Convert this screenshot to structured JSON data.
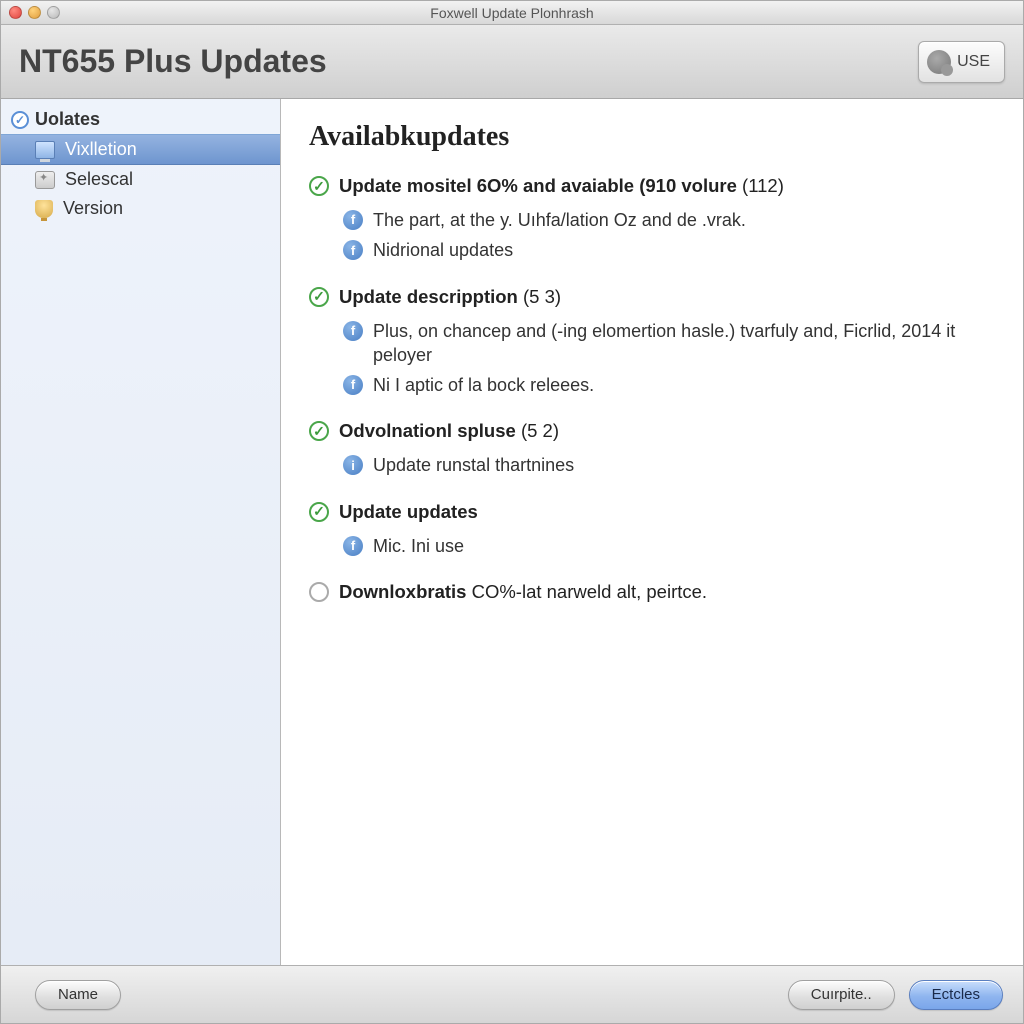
{
  "window": {
    "title": "Foxwell Update Plonhrash"
  },
  "toolbar": {
    "page_title": "NT655 Plus Updates",
    "use_button": "USE"
  },
  "sidebar": {
    "header": "Uolates",
    "items": [
      {
        "label": "Vixlletion"
      },
      {
        "label": "Selescal"
      },
      {
        "label": "Version"
      }
    ]
  },
  "content": {
    "heading": "Availabkupdates",
    "groups": [
      {
        "checked": true,
        "title": "Update mositel 6O% and avaiable (910 volure",
        "count": "(112)",
        "details": [
          "The part, at the y. Uıhfa/lation Oz and de .vrak.",
          "Nidrional updates"
        ]
      },
      {
        "checked": true,
        "title": "Update descripption",
        "count": "(5 3)",
        "details": [
          "Plus, on chancep and (-ing elomertion hasle.) tvarfuly and, Ficrlid, 2014 it peloyer",
          "Ni I aptic of la bock releees."
        ]
      },
      {
        "checked": true,
        "title": "Odvolnationl spluse",
        "count": "(5 2)",
        "details": [
          "Update runstal thartnines"
        ]
      },
      {
        "checked": true,
        "title": "Update updates",
        "count": "",
        "details": [
          "Mic. Ini use"
        ]
      },
      {
        "checked": false,
        "title_bold": "Downloxbratis",
        "title_rest": " CO%-lat narweld alt, peirtce.",
        "count": "",
        "details": []
      }
    ]
  },
  "footer": {
    "name_button": "Name",
    "curpite_button": "Cuırpite..",
    "primary_button": "Ectcles"
  }
}
